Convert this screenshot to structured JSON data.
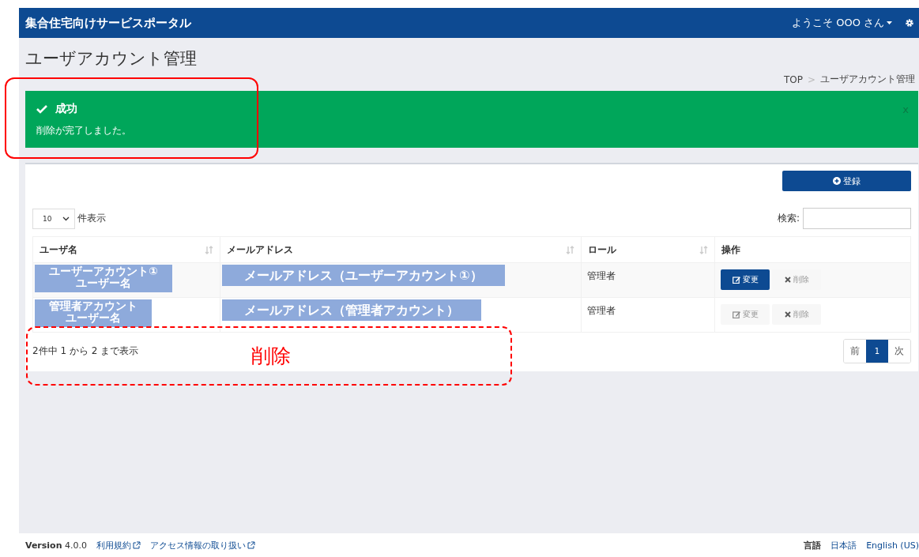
{
  "header": {
    "title": "集合住宅向けサービスポータル",
    "user_menu": "ようこそ OOO さん"
  },
  "page": {
    "title": "ユーザアカウント管理",
    "breadcrumb": {
      "separator": ">",
      "items": [
        {
          "label": "TOP"
        },
        {
          "label": "ユーザアカウント管理"
        }
      ]
    }
  },
  "alert": {
    "title": "成功",
    "message": "削除が完了しました。",
    "close": "x"
  },
  "panel": {
    "add_button": "登録",
    "page_size": "10",
    "page_size_suffix": "件表示",
    "search_label": "検索:",
    "table": {
      "columns": [
        {
          "label": "ユーザ名",
          "sortable": true
        },
        {
          "label": "メールアドレス",
          "sortable": true
        },
        {
          "label": "ロール",
          "sortable": true
        },
        {
          "label": "操作",
          "sortable": false
        }
      ],
      "rows": [
        {
          "username": {
            "lines": [
              "ユーザーアカウント①",
              "ユーザー名"
            ],
            "redacted": true
          },
          "email": {
            "text": "メールアドレス（ユーザーアカウント①）",
            "redacted": true
          },
          "role": "管理者",
          "actions": [
            {
              "kind": "edit",
              "label": "変更",
              "disabled": false
            },
            {
              "kind": "delete",
              "label": "削除",
              "disabled": true
            }
          ]
        },
        {
          "username": {
            "lines": [
              "管理者アカウント",
              "ユーザー名"
            ],
            "redacted": true
          },
          "email": {
            "text": "メールアドレス（管理者アカウント）",
            "redacted": true
          },
          "role": "管理者",
          "actions": [
            {
              "kind": "edit",
              "label": "変更",
              "disabled": true
            },
            {
              "kind": "delete",
              "label": "削除",
              "disabled": true
            }
          ]
        }
      ]
    },
    "info": "2件中 1 から 2 まで表示",
    "pagination": [
      {
        "label": "前",
        "selected": false
      },
      {
        "label": "1",
        "selected": true
      },
      {
        "label": "次",
        "selected": false
      }
    ]
  },
  "annotations": [
    {
      "kind": "solid"
    },
    {
      "kind": "dashed",
      "label": "削除"
    }
  ],
  "footer": {
    "version_label": "Version",
    "version": "4.0.0",
    "links": [
      {
        "label": "利用規約"
      },
      {
        "label": "アクセス情報の取り扱い"
      }
    ],
    "language_label": "言語",
    "languages": [
      {
        "label": "日本語"
      },
      {
        "label": "English (US)"
      }
    ]
  }
}
